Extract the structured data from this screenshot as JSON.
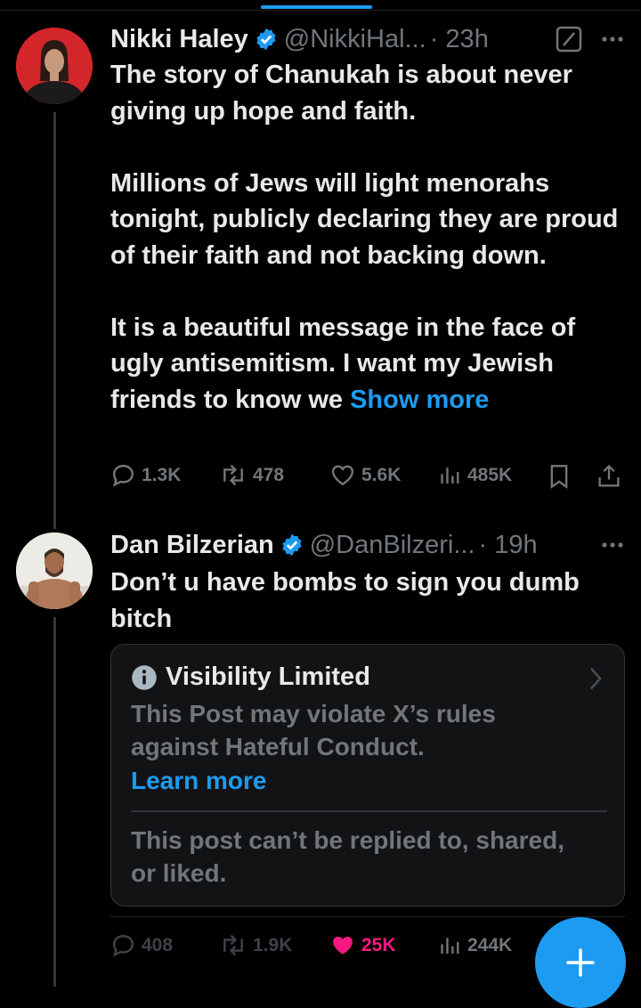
{
  "tweet1": {
    "name": "Nikki Haley",
    "handle": "@NikkiHal...",
    "time": "· 23h",
    "paragraphs": [
      "The story of Chanukah is about never giving up hope and faith.",
      "Millions of Jews will light menorahs tonight, publicly declaring they are proud of their faith and not backing down."
    ],
    "last_paragraph_text": "It is a beautiful message in the face of ugly antisemitism. I want my Jewish friends to know we",
    "show_more": "Show more",
    "actions": {
      "replies": "1.3K",
      "reposts": "478",
      "likes": "5.6K",
      "views": "485K"
    }
  },
  "tweet2": {
    "name": "Dan Bilzerian",
    "handle": "@DanBilzeri...",
    "time": "· 19h",
    "text": "Don’t u have bombs to sign you dumb bitch",
    "notice": {
      "title": "Visibility Limited",
      "body": "This Post may violate X’s rules against Hateful Conduct.",
      "learn_more": "Learn more",
      "footer": "This post can’t be replied to, shared, or liked."
    },
    "actions": {
      "replies": "408",
      "reposts": "1.9K",
      "likes": "25K",
      "views": "244K"
    }
  },
  "colors": {
    "accent": "#1d9bf0",
    "like": "#f91880",
    "muted": "#71767b",
    "text": "#e7e9ea",
    "background": "#000000"
  },
  "fab": {
    "icon": "plus-icon"
  }
}
